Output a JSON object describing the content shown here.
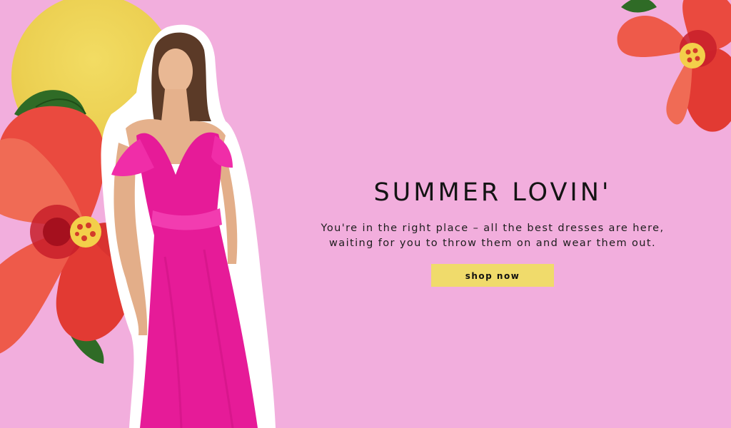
{
  "promo": {
    "headline": "SUMMER LOVIN'",
    "subtext_line1": "You're in the right place – all the best dresses are here,",
    "subtext_line2": "waiting for you to throw them on and wear them out.",
    "cta_label": "shop now"
  },
  "colors": {
    "background": "#f2aedd",
    "sun": "#ecd052",
    "button": "#f0db6b",
    "dress": "#e61b98",
    "hibiscus": "#e8413c"
  }
}
